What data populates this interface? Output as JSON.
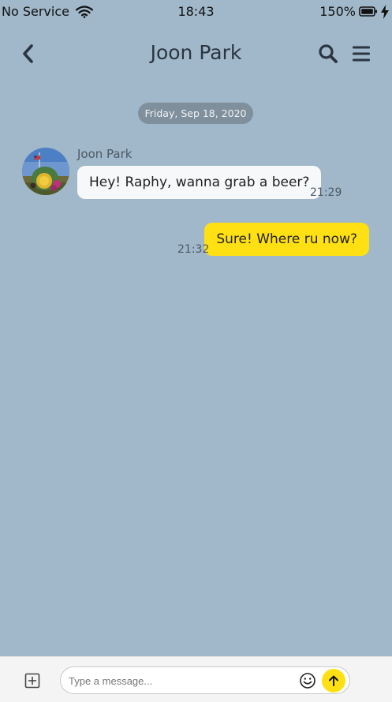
{
  "status_bar": {
    "carrier": "No Service",
    "time": "18:43",
    "battery": "150%"
  },
  "header": {
    "title": "Joon Park"
  },
  "icons": {
    "back": "chevron-left-icon",
    "search": "search-icon",
    "menu": "hamburger-menu-icon",
    "add": "add-square-icon",
    "emoji": "emoji-icon",
    "send": "arrow-up-icon"
  },
  "chat": {
    "date_separator": "Friday, Sep 18, 2020",
    "messages": [
      {
        "direction": "incoming",
        "sender": "Joon Park",
        "text": "Hey! Raphy, wanna grab a beer?",
        "time": "21:29"
      },
      {
        "direction": "outgoing",
        "text": "Sure! Where ru now?",
        "time": "21:32"
      }
    ]
  },
  "composer": {
    "value": "",
    "placeholder": "Type a message..."
  },
  "colors": {
    "background": "#a0b8c9",
    "outgoing_bubble": "#ffe013",
    "incoming_bubble": "#f7f8fa",
    "date_pill": "#7f8f9c"
  }
}
